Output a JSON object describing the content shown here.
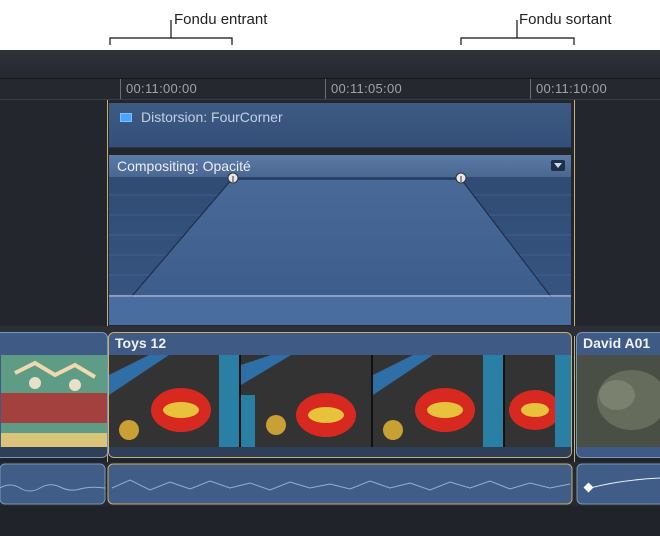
{
  "callouts": {
    "fade_in": "Fondu entrant",
    "fade_out": "Fondu sortant"
  },
  "timeline": {
    "timecodes": [
      "00:11:00:00",
      "00:11:05:00",
      "00:11:10:00"
    ]
  },
  "effect": {
    "label": "Distorsion: FourCorner",
    "swatch_color": "#4aa3ff"
  },
  "compositing": {
    "label": "Compositing: Opacité"
  },
  "clips": {
    "main_title": "Toys 12",
    "right_title": "David A01"
  },
  "colors": {
    "selection_outline": "#c9b070",
    "clip_blue": "#3e5a85",
    "background": "#202329"
  }
}
